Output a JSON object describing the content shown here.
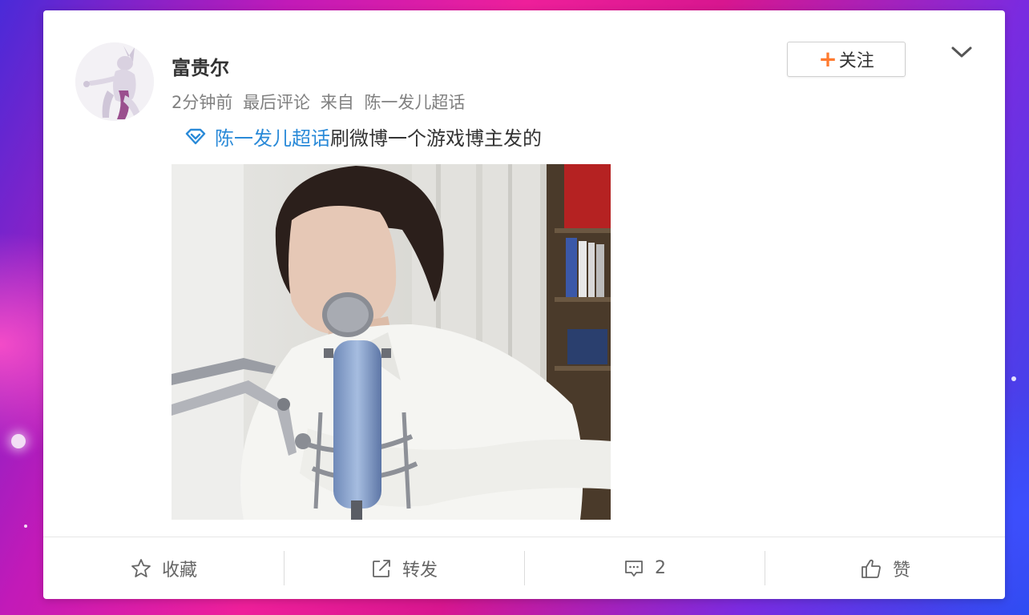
{
  "post": {
    "username": "富贵尔",
    "time": "2分钟前",
    "last_comment": "最后评论",
    "source_prefix": "来自",
    "source": "陈一发儿超话",
    "content_link": "陈一发儿超话",
    "content_text": "刷微博一个游戏博主发的"
  },
  "header": {
    "follow_label": "关注"
  },
  "actions": {
    "favorite_label": "收藏",
    "repost_label": "转发",
    "comment_count": "2",
    "like_label": "赞"
  },
  "colors": {
    "link": "#2a8ad8",
    "follow_plus": "#ff7a2f",
    "text": "#333333",
    "meta": "#808080"
  },
  "icons": [
    "chevron-down-icon",
    "supertopic-icon",
    "star-icon",
    "share-icon",
    "comment-icon",
    "thumbs-up-icon"
  ]
}
